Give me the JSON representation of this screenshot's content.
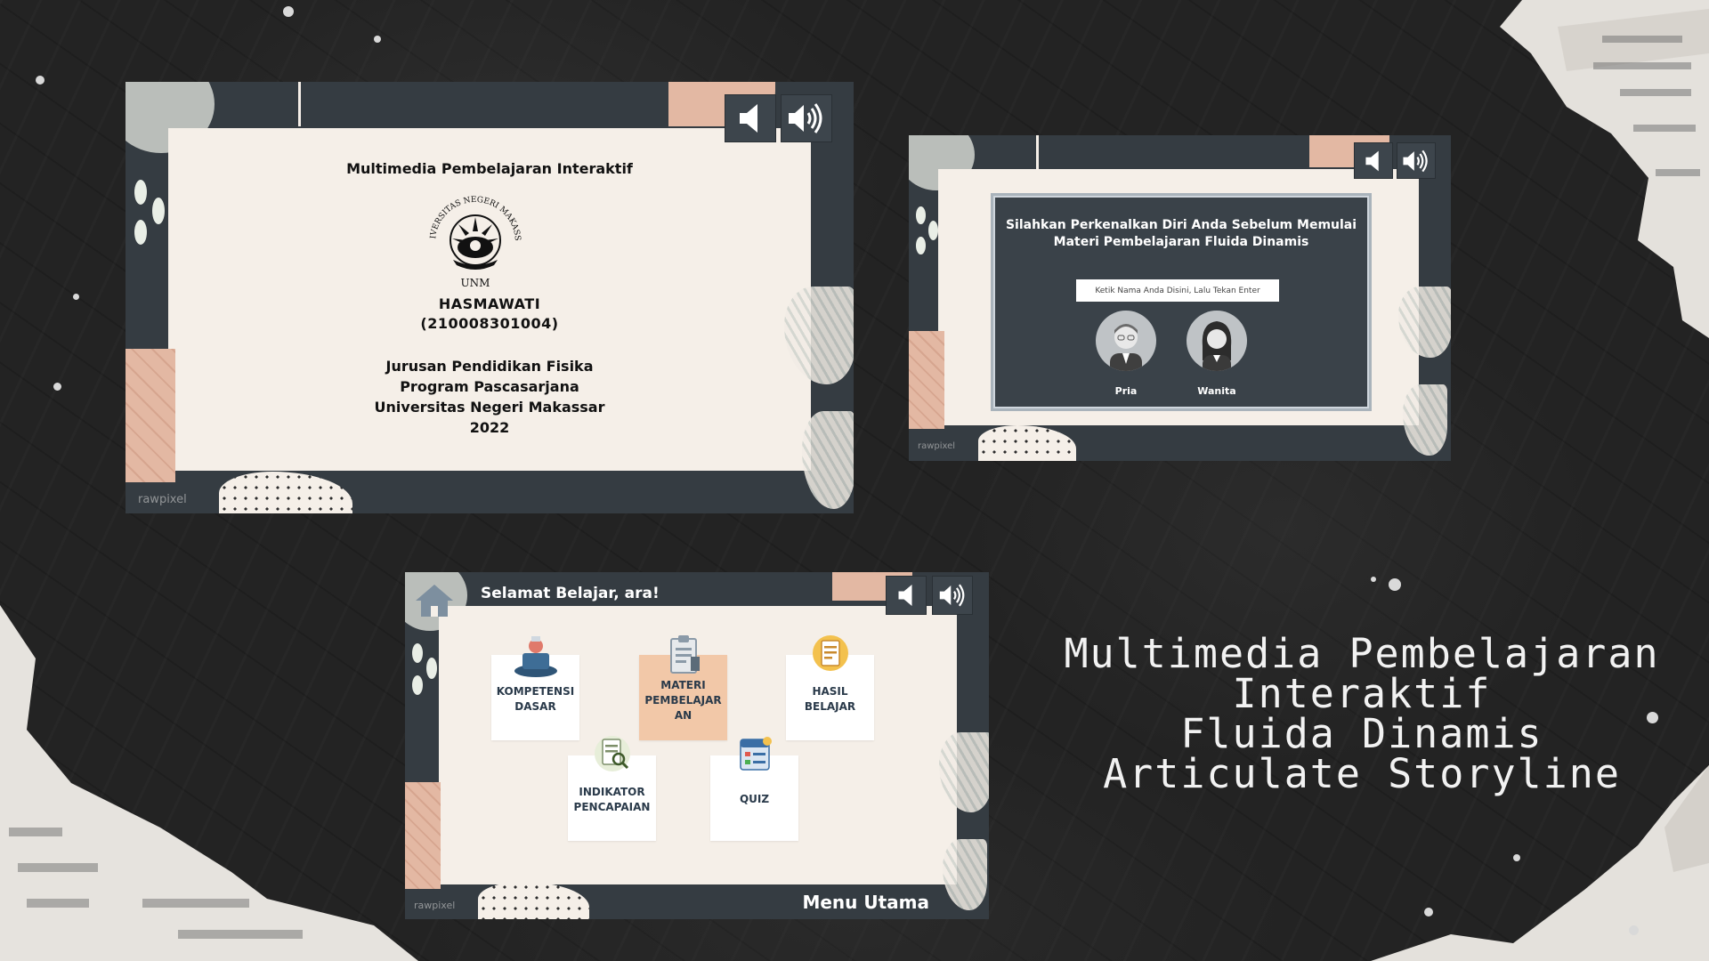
{
  "slide1": {
    "title": "Multimedia Pembelajaran Interaktif",
    "logo_text": {
      "arc": "UNIVERSITAS NEGERI MAKASSAR",
      "abbr": "UNM"
    },
    "author_name": "HASMAWATI",
    "author_id": "(210008301004)",
    "department": "Jurusan Pendidikan Fisika",
    "program": "Program Pascasarjana",
    "university": "Universitas Negeri Makassar",
    "year": "2022",
    "watermark": "rawpixel",
    "icons": [
      "speaker-mute-icon",
      "speaker-volume-icon"
    ]
  },
  "slide2": {
    "heading_line1": "Silahkan Perkenalkan Diri Anda Sebelum Memulai",
    "heading_line2": "Materi Pembelajaran Fluida Dinamis",
    "name_input_placeholder": "Ketik Nama Anda Disini, Lalu Tekan Enter",
    "option_male": "Pria",
    "option_female": "Wanita",
    "watermark": "rawpixel"
  },
  "slide3": {
    "greeting": "Selamat Belajar, ara!",
    "footer_title": "Menu Utama",
    "watermark": "rawpixel",
    "menu": [
      {
        "line1": "KOMPETENSI",
        "line2": "DASAR",
        "line3": "",
        "icon": "presentation-icon",
        "active": false
      },
      {
        "line1": "MATERI",
        "line2": "PEMBELAJAR",
        "line3": "AN",
        "icon": "clipboard-icon",
        "active": true
      },
      {
        "line1": "HASIL",
        "line2": "BELAJAR",
        "line3": "",
        "icon": "report-icon",
        "active": false
      },
      {
        "line1": "INDIKATOR",
        "line2": "PENCAPAIAN",
        "line3": "",
        "icon": "document-search-icon",
        "active": false
      },
      {
        "line1": "QUIZ",
        "line2": "",
        "line3": "",
        "icon": "quiz-icon",
        "active": false
      }
    ]
  },
  "caption": {
    "line1": "Multimedia Pembelajaran",
    "line2": "Interaktif",
    "line3": "Fluida Dinamis",
    "line4": "Articulate Storyline"
  },
  "colors": {
    "slide_frame": "#353c42",
    "card": "#f5efe8",
    "peach_accent": "#e3b8a3",
    "active_tile": "#f2c8a8",
    "background": "#232323"
  }
}
